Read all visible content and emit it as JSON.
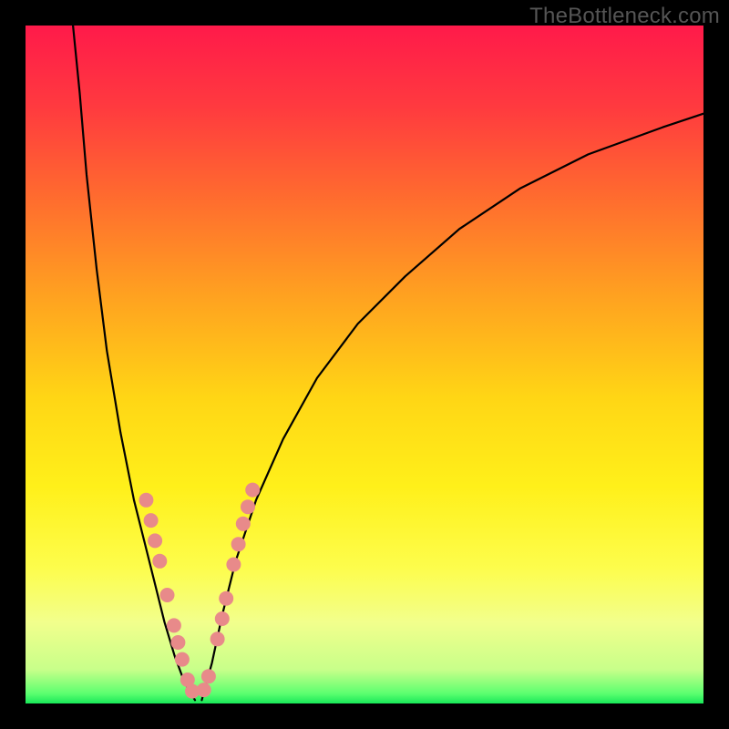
{
  "watermark": {
    "text": "TheBottleneck.com"
  },
  "gradient": {
    "stops": [
      {
        "pos": 0.0,
        "color": "#ff1a4a"
      },
      {
        "pos": 0.12,
        "color": "#ff3a3f"
      },
      {
        "pos": 0.25,
        "color": "#ff6a2f"
      },
      {
        "pos": 0.4,
        "color": "#ffa220"
      },
      {
        "pos": 0.55,
        "color": "#ffd615"
      },
      {
        "pos": 0.68,
        "color": "#fff01a"
      },
      {
        "pos": 0.8,
        "color": "#fdfd4c"
      },
      {
        "pos": 0.88,
        "color": "#f2ff8c"
      },
      {
        "pos": 0.95,
        "color": "#c8ff8a"
      },
      {
        "pos": 0.985,
        "color": "#5dff70"
      },
      {
        "pos": 1.0,
        "color": "#18e858"
      }
    ]
  },
  "curve_style": {
    "stroke": "#000000",
    "stroke_width": 2.2
  },
  "marker_style": {
    "fill": "#e88a8a",
    "radius": 8
  },
  "chart_data": {
    "type": "line",
    "title": "",
    "xlabel": "",
    "ylabel": "",
    "xlim": [
      0,
      100
    ],
    "ylim": [
      0,
      100
    ],
    "series": [
      {
        "name": "left-branch",
        "x": [
          7.0,
          8.0,
          9.0,
          10.5,
          12.0,
          14.0,
          16.0,
          17.5,
          19.0,
          20.5,
          22.0,
          23.5,
          25.0
        ],
        "y": [
          100.0,
          90.0,
          78.0,
          64.0,
          52.0,
          40.0,
          30.0,
          24.0,
          18.0,
          12.0,
          7.0,
          3.0,
          0.5
        ]
      },
      {
        "name": "right-branch",
        "x": [
          26.0,
          27.5,
          29.0,
          31.0,
          34.0,
          38.0,
          43.0,
          49.0,
          56.0,
          64.0,
          73.0,
          83.0,
          94.0,
          100.0
        ],
        "y": [
          0.5,
          6.0,
          13.0,
          21.0,
          30.0,
          39.0,
          48.0,
          56.0,
          63.0,
          70.0,
          76.0,
          81.0,
          85.0,
          87.0
        ]
      }
    ],
    "markers": [
      {
        "series": "left-branch",
        "x": 17.8,
        "y": 30.0
      },
      {
        "series": "left-branch",
        "x": 18.5,
        "y": 27.0
      },
      {
        "series": "left-branch",
        "x": 19.1,
        "y": 24.0
      },
      {
        "series": "left-branch",
        "x": 19.8,
        "y": 21.0
      },
      {
        "series": "left-branch",
        "x": 20.9,
        "y": 16.0
      },
      {
        "series": "left-branch",
        "x": 21.9,
        "y": 11.5
      },
      {
        "series": "left-branch",
        "x": 22.5,
        "y": 9.0
      },
      {
        "series": "left-branch",
        "x": 23.1,
        "y": 6.5
      },
      {
        "series": "left-branch",
        "x": 23.9,
        "y": 3.5
      },
      {
        "series": "left-branch",
        "x": 24.6,
        "y": 1.8
      },
      {
        "series": "right-branch",
        "x": 26.3,
        "y": 2.0
      },
      {
        "series": "right-branch",
        "x": 27.0,
        "y": 4.0
      },
      {
        "series": "right-branch",
        "x": 28.3,
        "y": 9.5
      },
      {
        "series": "right-branch",
        "x": 29.0,
        "y": 12.5
      },
      {
        "series": "right-branch",
        "x": 29.6,
        "y": 15.5
      },
      {
        "series": "right-branch",
        "x": 30.7,
        "y": 20.5
      },
      {
        "series": "right-branch",
        "x": 31.4,
        "y": 23.5
      },
      {
        "series": "right-branch",
        "x": 32.1,
        "y": 26.5
      },
      {
        "series": "right-branch",
        "x": 32.8,
        "y": 29.0
      },
      {
        "series": "right-branch",
        "x": 33.5,
        "y": 31.5
      }
    ]
  }
}
